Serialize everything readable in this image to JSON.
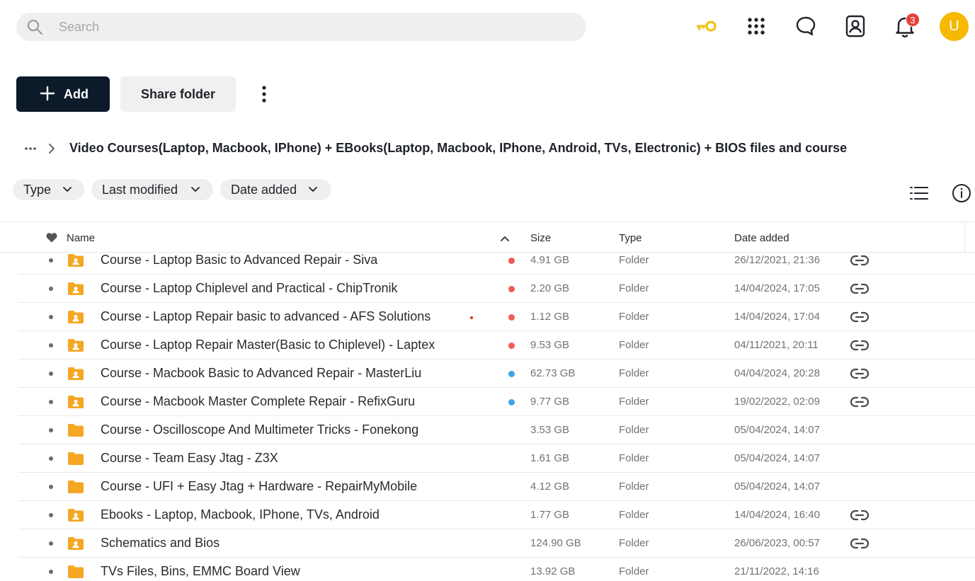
{
  "header": {
    "search_placeholder": "Search",
    "notification_count": "3",
    "avatar_initial": "U",
    "icons": [
      "search-icon",
      "key-icon",
      "apps-grid-icon",
      "chat-icon",
      "contacts-icon",
      "bell-icon"
    ],
    "key_color": "#f0c419"
  },
  "toolbar": {
    "add_label": "Add",
    "share_label": "Share folder"
  },
  "breadcrumb": {
    "title": "Video Courses(Laptop, Macbook, IPhone) + EBooks(Laptop, Macbook, IPhone, Android, TVs, Electronic) + BIOS files and course"
  },
  "filters": [
    "Type",
    "Last modified",
    "Date added"
  ],
  "table": {
    "columns": {
      "name": "Name",
      "size": "Size",
      "type": "Type",
      "date": "Date added"
    },
    "rows": [
      {
        "name": "Course - Laptop Basic to Advanced Repair - Siva",
        "size": "4.91 GB",
        "type": "Folder",
        "date": "26/12/2021, 21:36",
        "shared": true,
        "label_color": "#f25a54"
      },
      {
        "name": "Course - Laptop Chiplevel and Practical - ChipTronik",
        "size": "2.20 GB",
        "type": "Folder",
        "date": "14/04/2024, 17:05",
        "shared": true,
        "label_color": "#f25a54"
      },
      {
        "name": "Course - Laptop Repair basic to advanced - AFS Solutions",
        "size": "1.12 GB",
        "type": "Folder",
        "date": "14/04/2024, 17:04",
        "shared": true,
        "label_color": "#f25a54",
        "extra_dot": true
      },
      {
        "name": "Course - Laptop Repair Master(Basic to Chiplevel) - Laptex",
        "size": "9.53 GB",
        "type": "Folder",
        "date": "04/11/2021, 20:11",
        "shared": true,
        "label_color": "#f25a54"
      },
      {
        "name": "Course - Macbook Basic to Advanced Repair - MasterLiu",
        "size": "62.73 GB",
        "type": "Folder",
        "date": "04/04/2024, 20:28",
        "shared": true,
        "label_color": "#3aa6e6"
      },
      {
        "name": "Course - Macbook Master Complete Repair - RefixGuru",
        "size": "9.77 GB",
        "type": "Folder",
        "date": "19/02/2022, 02:09",
        "shared": true,
        "label_color": "#3aa6e6"
      },
      {
        "name": "Course - Oscilloscope And Multimeter Tricks - Fonekong",
        "size": "3.53 GB",
        "type": "Folder",
        "date": "05/04/2024, 14:07",
        "shared": false,
        "label_color": ""
      },
      {
        "name": "Course - Team Easy Jtag - Z3X",
        "size": "1.61 GB",
        "type": "Folder",
        "date": "05/04/2024, 14:07",
        "shared": false,
        "label_color": ""
      },
      {
        "name": "Course - UFI + Easy Jtag + Hardware - RepairMyMobile",
        "size": "4.12 GB",
        "type": "Folder",
        "date": "05/04/2024, 14:07",
        "shared": false,
        "label_color": ""
      },
      {
        "name": "Ebooks - Laptop, Macbook, IPhone, TVs, Android",
        "size": "1.77 GB",
        "type": "Folder",
        "date": "14/04/2024, 16:40",
        "shared": true,
        "label_color": ""
      },
      {
        "name": "Schematics and Bios",
        "size": "124.90 GB",
        "type": "Folder",
        "date": "26/06/2023, 00:57",
        "shared": true,
        "label_color": ""
      },
      {
        "name": "TVs Files, Bins, EMMC Board View",
        "size": "13.92 GB",
        "type": "Folder",
        "date": "21/11/2022, 14:16",
        "shared": false,
        "label_color": ""
      }
    ]
  }
}
